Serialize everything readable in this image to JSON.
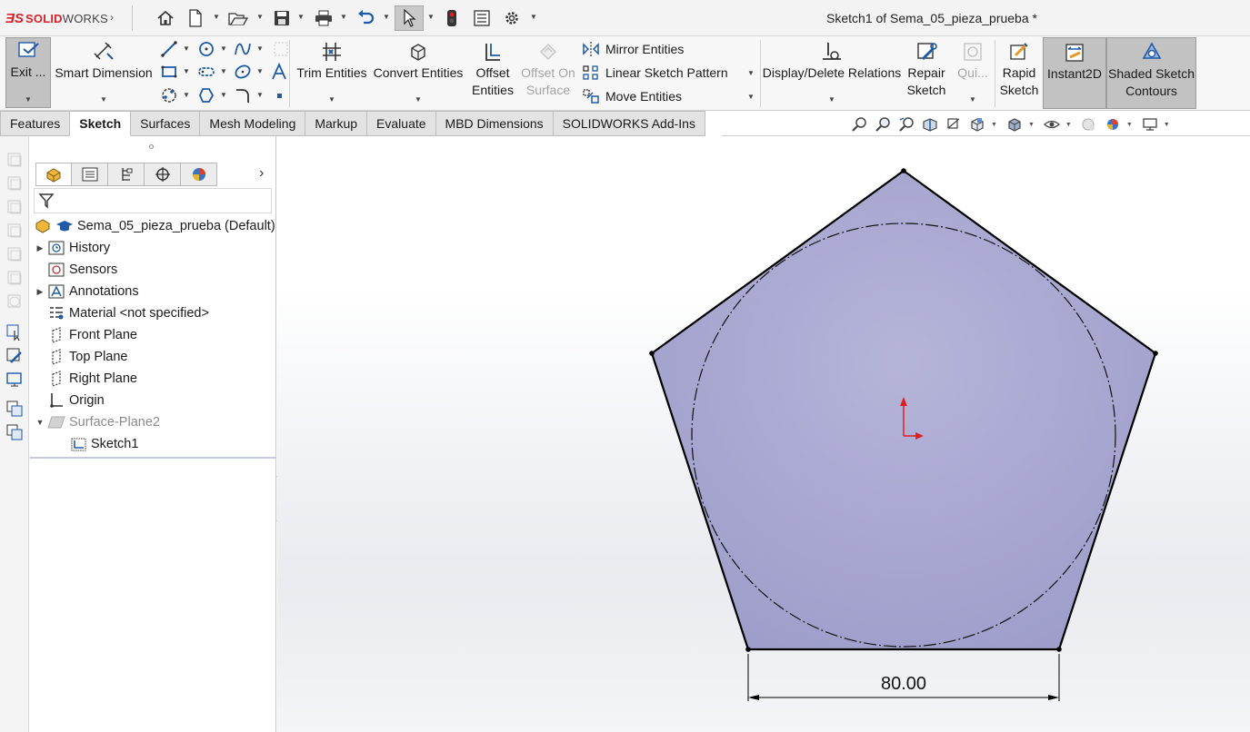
{
  "app": {
    "logo_ds": "ƎS",
    "logo_brand": "SOLID",
    "logo_brand_rest": "WORKS",
    "document_title": "Sketch1 of Sema_05_pieza_prueba *"
  },
  "quick_access": [
    "home-icon",
    "new-document-icon",
    "open-icon",
    "save-icon",
    "print-icon",
    "undo-icon",
    "select-icon",
    "rebuild-icon",
    "file-properties-icon",
    "options-icon"
  ],
  "commands": {
    "exit": "Exit ...",
    "smart_dimension": "Smart Dimension",
    "trim_entities": "Trim Entities",
    "convert_entities": "Convert Entities",
    "offset_entities": [
      "Offset",
      "Entities"
    ],
    "offset_on_surface": [
      "Offset On",
      "Surface"
    ],
    "mirror_entities": "Mirror Entities",
    "linear_sketch_pattern": "Linear Sketch Pattern",
    "move_entities": "Move Entities",
    "display_delete_relations": "Display/Delete Relations",
    "repair_sketch": [
      "Repair",
      "Sketch"
    ],
    "quick_snaps": "Qui...",
    "rapid_sketch": [
      "Rapid",
      "Sketch"
    ],
    "instant2d": "Instant2D",
    "shaded_sketch_contours": [
      "Shaded Sketch",
      "Contours"
    ]
  },
  "tabs": [
    {
      "label": "Features",
      "active": false
    },
    {
      "label": "Sketch",
      "active": true
    },
    {
      "label": "Surfaces",
      "active": false
    },
    {
      "label": "Mesh Modeling",
      "active": false
    },
    {
      "label": "Markup",
      "active": false
    },
    {
      "label": "Evaluate",
      "active": false
    },
    {
      "label": "MBD Dimensions",
      "active": false
    },
    {
      "label": "SOLIDWORKS Add-Ins",
      "active": false
    }
  ],
  "feature_tree": {
    "root": "Sema_05_pieza_prueba  (Default)",
    "items": [
      {
        "label": "History",
        "expandable": true,
        "icon": "history-icon"
      },
      {
        "label": "Sensors",
        "expandable": false,
        "icon": "sensors-icon"
      },
      {
        "label": "Annotations",
        "expandable": true,
        "icon": "annotations-icon"
      },
      {
        "label": "Material <not specified>",
        "expandable": false,
        "icon": "material-icon"
      },
      {
        "label": "Front Plane",
        "expandable": false,
        "icon": "plane-icon"
      },
      {
        "label": "Top Plane",
        "expandable": false,
        "icon": "plane-icon"
      },
      {
        "label": "Right Plane",
        "expandable": false,
        "icon": "plane-icon"
      },
      {
        "label": "Origin",
        "expandable": false,
        "icon": "origin-icon"
      },
      {
        "label": "Surface-Plane2",
        "expandable": true,
        "expanded": true,
        "icon": "surface-plane-icon",
        "suppressed": true
      },
      {
        "label": "Sketch1",
        "expandable": false,
        "icon": "sketch-icon",
        "child": true
      }
    ]
  },
  "sketch": {
    "dimension": "80.00",
    "shape": "pentagon",
    "construction": "circle",
    "fill_color": "#a7a7d2",
    "line_color": "#000000"
  }
}
